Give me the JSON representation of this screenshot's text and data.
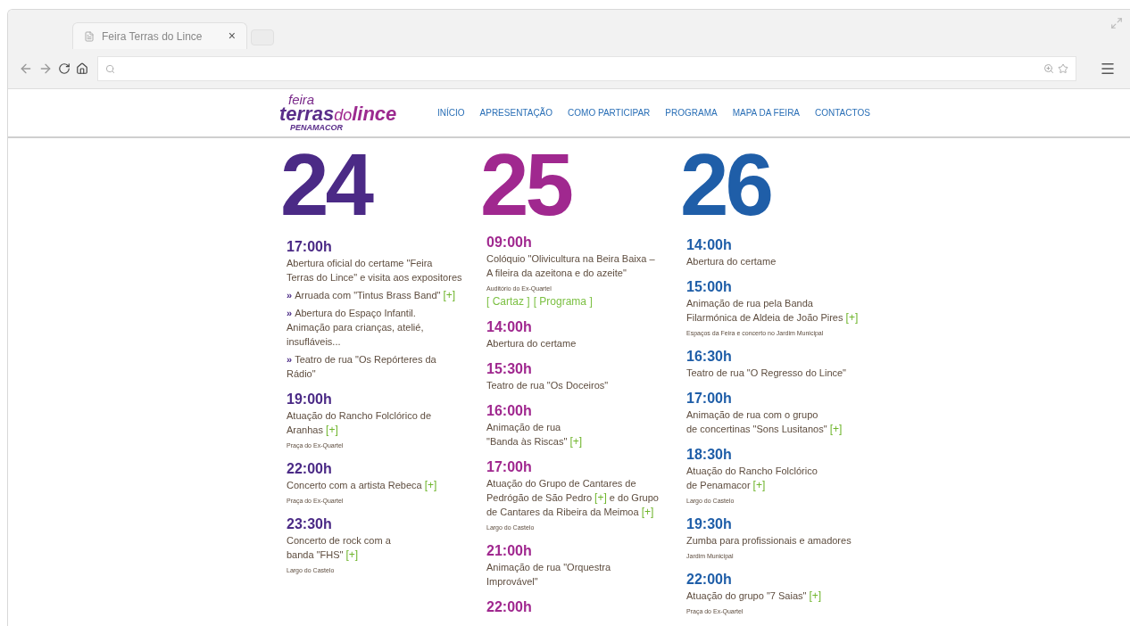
{
  "browser": {
    "tab": {
      "title": "Feira Terras do Lince",
      "close": "×"
    }
  },
  "site": {
    "logo": {
      "top": "feira",
      "word_1": "terras",
      "word_2": "do",
      "word_3": "lince",
      "sub": "PENAMACOR"
    },
    "nav": [
      {
        "label": "INÍCIO"
      },
      {
        "label": "APRESENTAÇÃO"
      },
      {
        "label": "COMO PARTICIPAR"
      },
      {
        "label": "PROGRAMA"
      },
      {
        "label": "MAPA DA FEIRA"
      },
      {
        "label": "CONTACTOS"
      }
    ]
  },
  "days": [
    {
      "day": "24",
      "color": "#4b2a86",
      "events": [
        {
          "time": "17:00h",
          "paragraphs": [
            {
              "kind": "text",
              "parts": [
                {
                  "kind": "text",
                  "text": "Abertura oficial do certame \"Feira"
                },
                {
                  "kind": "break"
                },
                {
                  "kind": "text",
                  "text": "Terras do Lince\" e visita aos expositores"
                }
              ]
            },
            {
              "kind": "bullet",
              "bullet": "»",
              "parts": [
                {
                  "kind": "text",
                  "text": "Arruada com \"Tintus Brass Band\""
                },
                {
                  "kind": "link",
                  "text": "[+]"
                }
              ]
            },
            {
              "kind": "bullet",
              "bullet": "»",
              "parts": [
                {
                  "kind": "text",
                  "text": "Abertura do Espaço Infantil."
                },
                {
                  "kind": "break"
                },
                {
                  "kind": "text",
                  "text": "Animação para crianças, atelié,"
                },
                {
                  "kind": "break"
                },
                {
                  "kind": "text",
                  "text": "insufláveis..."
                }
              ]
            },
            {
              "kind": "bullet",
              "bullet": "»",
              "parts": [
                {
                  "kind": "text",
                  "text": "Teatro de rua \"Os Repórteres da"
                },
                {
                  "kind": "break"
                },
                {
                  "kind": "text",
                  "text": "Rádio\""
                }
              ]
            }
          ]
        },
        {
          "time": "19:00h",
          "paragraphs": [
            {
              "kind": "text",
              "parts": [
                {
                  "kind": "text",
                  "text": "Atuação do Rancho Folclórico de"
                },
                {
                  "kind": "break"
                },
                {
                  "kind": "text",
                  "text": "Aranhas"
                },
                {
                  "kind": "link",
                  "text": "[+]"
                }
              ]
            },
            {
              "kind": "note",
              "parts": [
                {
                  "kind": "text",
                  "text": "Praça do Ex-Quartel"
                }
              ]
            }
          ]
        },
        {
          "time": "22:00h",
          "paragraphs": [
            {
              "kind": "text",
              "parts": [
                {
                  "kind": "text",
                  "text": "Concerto com a artista Rebeca"
                },
                {
                  "kind": "link",
                  "text": "[+]"
                }
              ]
            },
            {
              "kind": "note",
              "parts": [
                {
                  "kind": "text",
                  "text": "Praça do Ex-Quartel"
                }
              ]
            }
          ]
        },
        {
          "time": "23:30h",
          "paragraphs": [
            {
              "kind": "text",
              "parts": [
                {
                  "kind": "text",
                  "text": "Concerto de rock com a"
                },
                {
                  "kind": "break"
                },
                {
                  "kind": "text",
                  "text": "banda \"FHS\""
                },
                {
                  "kind": "link",
                  "text": "[+]"
                }
              ]
            },
            {
              "kind": "note",
              "parts": [
                {
                  "kind": "text",
                  "text": "Largo do Castelo"
                }
              ]
            }
          ]
        }
      ]
    },
    {
      "day": "25",
      "color": "#a0288f",
      "events": [
        {
          "time": "09:00h",
          "paragraphs": [
            {
              "kind": "text",
              "parts": [
                {
                  "kind": "text",
                  "text": "Colóquio \"Olivicultura na Beira Baixa –"
                },
                {
                  "kind": "break"
                },
                {
                  "kind": "text",
                  "text": "A fileira da azeitona e do azeite\""
                }
              ]
            },
            {
              "kind": "note",
              "parts": [
                {
                  "kind": "text",
                  "text": "Auditório do Ex-Quartel"
                }
              ]
            },
            {
              "kind": "links",
              "parts": [
                {
                  "kind": "link",
                  "text": "[ Cartaz ]"
                },
                {
                  "kind": "link",
                  "text": "[ Programa ]"
                }
              ]
            }
          ]
        },
        {
          "time": "14:00h",
          "paragraphs": [
            {
              "kind": "text",
              "parts": [
                {
                  "kind": "text",
                  "text": "Abertura do certame"
                }
              ]
            }
          ]
        },
        {
          "time": "15:30h",
          "paragraphs": [
            {
              "kind": "text",
              "parts": [
                {
                  "kind": "text",
                  "text": "Teatro de rua \"Os Doceiros\""
                }
              ]
            }
          ]
        },
        {
          "time": "16:00h",
          "paragraphs": [
            {
              "kind": "text",
              "parts": [
                {
                  "kind": "text",
                  "text": "Animação de rua"
                },
                {
                  "kind": "break"
                },
                {
                  "kind": "text",
                  "text": "\"Banda às Riscas\""
                },
                {
                  "kind": "link",
                  "text": "[+]"
                }
              ]
            }
          ]
        },
        {
          "time": "17:00h",
          "paragraphs": [
            {
              "kind": "text",
              "parts": [
                {
                  "kind": "text",
                  "text": "Atuação do Grupo de Cantares de"
                },
                {
                  "kind": "break"
                },
                {
                  "kind": "text",
                  "text": "Pedrógão de São Pedro"
                },
                {
                  "kind": "link",
                  "text": "[+]"
                },
                {
                  "kind": "text",
                  "text": "e do Grupo"
                },
                {
                  "kind": "break"
                },
                {
                  "kind": "text",
                  "text": "de Cantares da Ribeira da Meimoa"
                },
                {
                  "kind": "link",
                  "text": "[+]"
                }
              ]
            },
            {
              "kind": "note",
              "parts": [
                {
                  "kind": "text",
                  "text": "Largo do Castelo"
                }
              ]
            }
          ]
        },
        {
          "time": "21:00h",
          "paragraphs": [
            {
              "kind": "text",
              "parts": [
                {
                  "kind": "text",
                  "text": "Animação de rua \"Orquestra"
                },
                {
                  "kind": "break"
                },
                {
                  "kind": "text",
                  "text": "Improvável\""
                }
              ]
            }
          ]
        },
        {
          "time": "22:00h"
        }
      ]
    },
    {
      "day": "26",
      "color": "#1f5ea8",
      "events": [
        {
          "time": "14:00h",
          "paragraphs": [
            {
              "kind": "text",
              "parts": [
                {
                  "kind": "text",
                  "text": "Abertura do certame"
                }
              ]
            }
          ]
        },
        {
          "time": "15:00h",
          "paragraphs": [
            {
              "kind": "text",
              "parts": [
                {
                  "kind": "text",
                  "text": "Animação de rua pela Banda"
                },
                {
                  "kind": "break"
                },
                {
                  "kind": "text",
                  "text": "Filarmónica de Aldeia de João Pires"
                },
                {
                  "kind": "link",
                  "text": "[+]"
                }
              ]
            },
            {
              "kind": "note",
              "parts": [
                {
                  "kind": "text",
                  "text": "Espaços da Feira e concerto no Jardim Municipal"
                }
              ]
            }
          ]
        },
        {
          "time": "16:30h",
          "paragraphs": [
            {
              "kind": "text",
              "parts": [
                {
                  "kind": "text",
                  "text": "Teatro de rua \"O Regresso do Lince\""
                }
              ]
            }
          ]
        },
        {
          "time": "17:00h",
          "paragraphs": [
            {
              "kind": "text",
              "parts": [
                {
                  "kind": "text",
                  "text": "Animação de rua com o grupo"
                },
                {
                  "kind": "break"
                },
                {
                  "kind": "text",
                  "text": "de concertinas \"Sons Lusitanos\""
                },
                {
                  "kind": "link",
                  "text": "[+]"
                }
              ]
            }
          ]
        },
        {
          "time": "18:30h",
          "paragraphs": [
            {
              "kind": "text",
              "parts": [
                {
                  "kind": "text",
                  "text": "Atuação do Rancho Folclórico"
                },
                {
                  "kind": "break"
                },
                {
                  "kind": "text",
                  "text": "de Penamacor"
                },
                {
                  "kind": "link",
                  "text": "[+]"
                }
              ]
            },
            {
              "kind": "note",
              "parts": [
                {
                  "kind": "text",
                  "text": "Largo do Castelo"
                }
              ]
            }
          ]
        },
        {
          "time": "19:30h",
          "paragraphs": [
            {
              "kind": "text",
              "parts": [
                {
                  "kind": "text",
                  "text": "Zumba para profissionais e amadores"
                }
              ]
            },
            {
              "kind": "note",
              "parts": [
                {
                  "kind": "text",
                  "text": "Jardim Municipal"
                }
              ]
            }
          ]
        },
        {
          "time": "22:00h",
          "paragraphs": [
            {
              "kind": "text",
              "parts": [
                {
                  "kind": "text",
                  "text": "Atuação do grupo \"7 Saias\""
                },
                {
                  "kind": "link",
                  "text": "[+]"
                }
              ]
            },
            {
              "kind": "note",
              "parts": [
                {
                  "kind": "text",
                  "text": "Praça do Ex-Quartel"
                }
              ]
            }
          ]
        }
      ]
    }
  ]
}
